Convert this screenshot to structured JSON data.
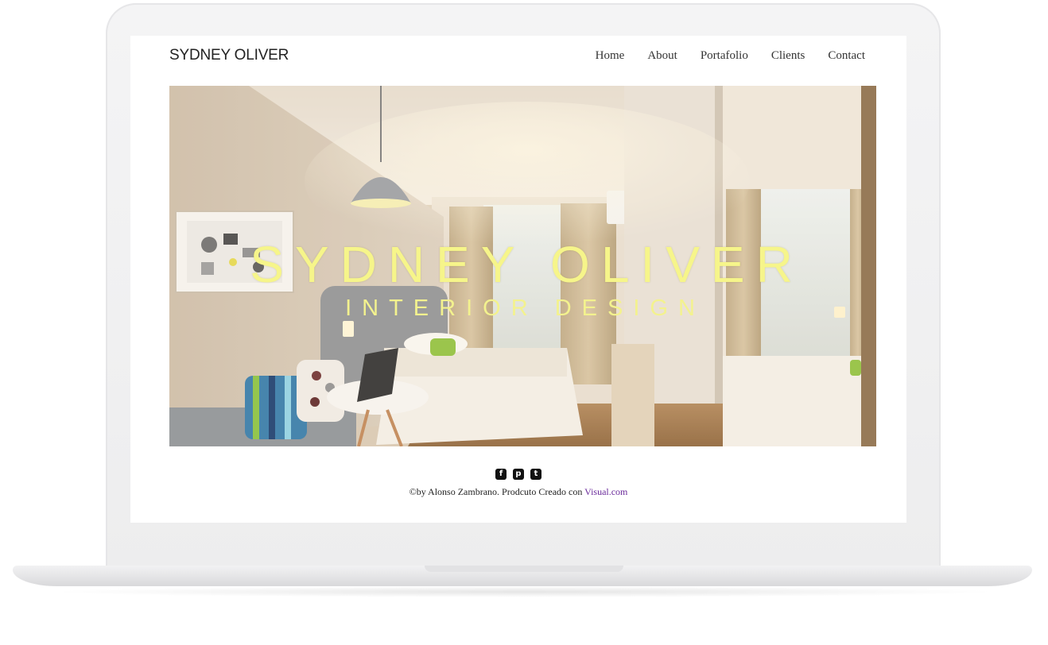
{
  "site": {
    "brand": "SYDNEY OLIVER",
    "nav": [
      "Home",
      "About",
      "Portafolio",
      "Clients",
      "Contact"
    ]
  },
  "hero": {
    "title": "SYDNEY OLIVER",
    "subtitle": "INTERIOR DESIGN",
    "image": "hotel-bedroom-photo"
  },
  "footer": {
    "social_icons": [
      "facebook-icon",
      "pinterest-icon",
      "twitter-icon"
    ],
    "credit_text": "©by Alonso Zambrano. Prodcuto Creado con ",
    "credit_link": "Visual.com"
  },
  "colors": {
    "hero_text": "#f6f58a",
    "link": "#6a2a9a",
    "device_frame": "#f0f0f1"
  }
}
